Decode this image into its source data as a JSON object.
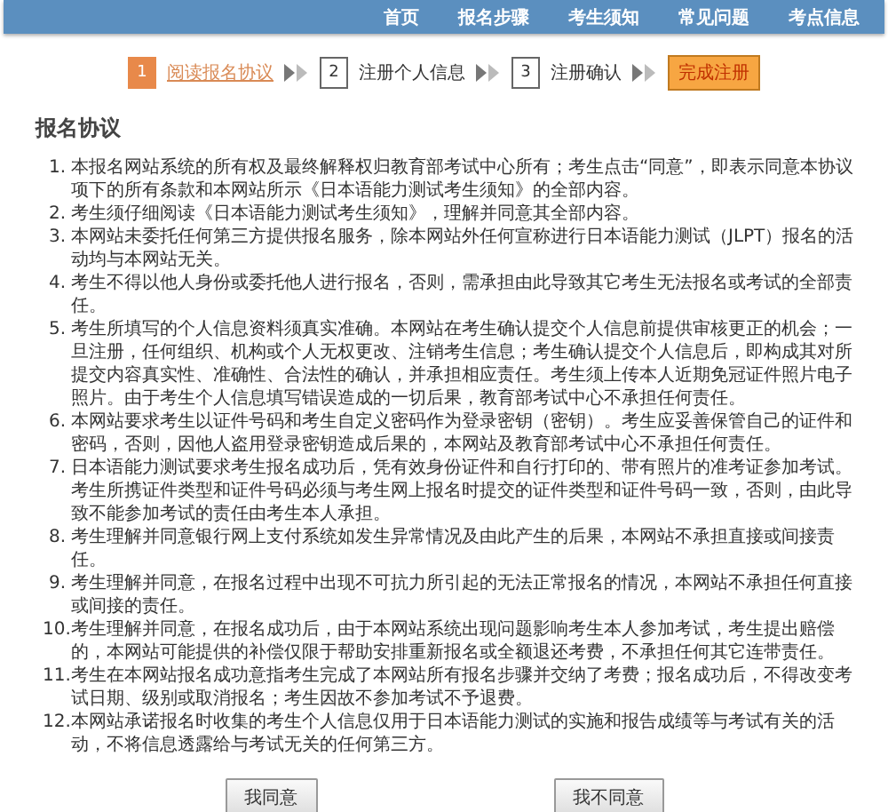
{
  "nav": {
    "items": [
      "首页",
      "报名步骤",
      "考生须知",
      "常见问题",
      "考点信息"
    ]
  },
  "steps": [
    {
      "kind": "step",
      "number": "1",
      "label": "阅读报名协议",
      "selected": true
    },
    {
      "kind": "step",
      "number": "2",
      "label": "注册个人信息",
      "selected": false
    },
    {
      "kind": "step",
      "number": "3",
      "label": "注册确认",
      "selected": false
    },
    {
      "kind": "finish",
      "label": "完成注册",
      "selected": false
    }
  ],
  "agreement": {
    "title": "报名协议",
    "items": [
      {
        "number": "1.",
        "text": "本报名网站系统的所有权及最终解释权归教育部考试中心所有；考生点击“同意”，即表示同意本协议项下的所有条款和本网站所示《日本语能力测试考生须知》的全部内容。"
      },
      {
        "number": "2.",
        "text": "考生须仔细阅读《日本语能力测试考生须知》，理解并同意其全部内容。"
      },
      {
        "number": "3.",
        "text": "本网站未委托任何第三方提供报名服务，除本网站外任何宣称进行日本语能力测试（JLPT）报名的活动均与本网站无关。"
      },
      {
        "number": "4.",
        "text": "考生不得以他人身份或委托他人进行报名，否则，需承担由此导致其它考生无法报名或考试的全部责任。"
      },
      {
        "number": "5.",
        "text": "考生所填写的个人信息资料须真实准确。本网站在考生确认提交个人信息前提供审核更正的机会；一旦注册，任何组织、机构或个人无权更改、注销考生信息；考生确认提交个人信息后，即构成其对所提交内容真实性、准确性、合法性的确认，并承担相应责任。考生须上传本人近期免冠证件照片电子照片。由于考生个人信息填写错误造成的一切后果，教育部考试中心不承担任何责任。"
      },
      {
        "number": "6.",
        "text": "本网站要求考生以证件号码和考生自定义密码作为登录密钥（密钥）。考生应妥善保管自己的证件和密码，否则，因他人盗用登录密钥造成后果的，本网站及教育部考试中心不承担任何责任。"
      },
      {
        "number": "7.",
        "text": "日本语能力测试要求考生报名成功后，凭有效身份证件和自行打印的、带有照片的准考证参加考试。考生所携证件类型和证件号码必须与考生网上报名时提交的证件类型和证件号码一致，否则，由此导致不能参加考试的责任由考生本人承担。"
      },
      {
        "number": "8.",
        "text": "考生理解并同意银行网上支付系统如发生异常情况及由此产生的后果，本网站不承担直接或间接责任。"
      },
      {
        "number": "9.",
        "text": "考生理解并同意，在报名过程中出现不可抗力所引起的无法正常报名的情况，本网站不承担任何直接或间接的责任。"
      },
      {
        "number": "10.",
        "text": "考生理解并同意，在报名成功后，由于本网站系统出现问题影响考生本人参加考试，考生提出赔偿的，本网站可能提供的补偿仅限于帮助安排重新报名或全额退还考费，不承担任何其它连带责任。"
      },
      {
        "number": "11.",
        "text": "考生在本网站报名成功意指考生完成了本网站所有报名步骤并交纳了考费；报名成功后，不得改变考试日期、级别或取消报名；考生因故不参加考试不予退费。"
      },
      {
        "number": "12.",
        "text": "本网站承诺报名时收集的考生个人信息仅用于日本语能力测试的实施和报告成绩等与考试有关的活动，不将信息透露给与考试无关的任何第三方。"
      }
    ]
  },
  "buttons": [
    "我同意",
    "我不同意"
  ]
}
